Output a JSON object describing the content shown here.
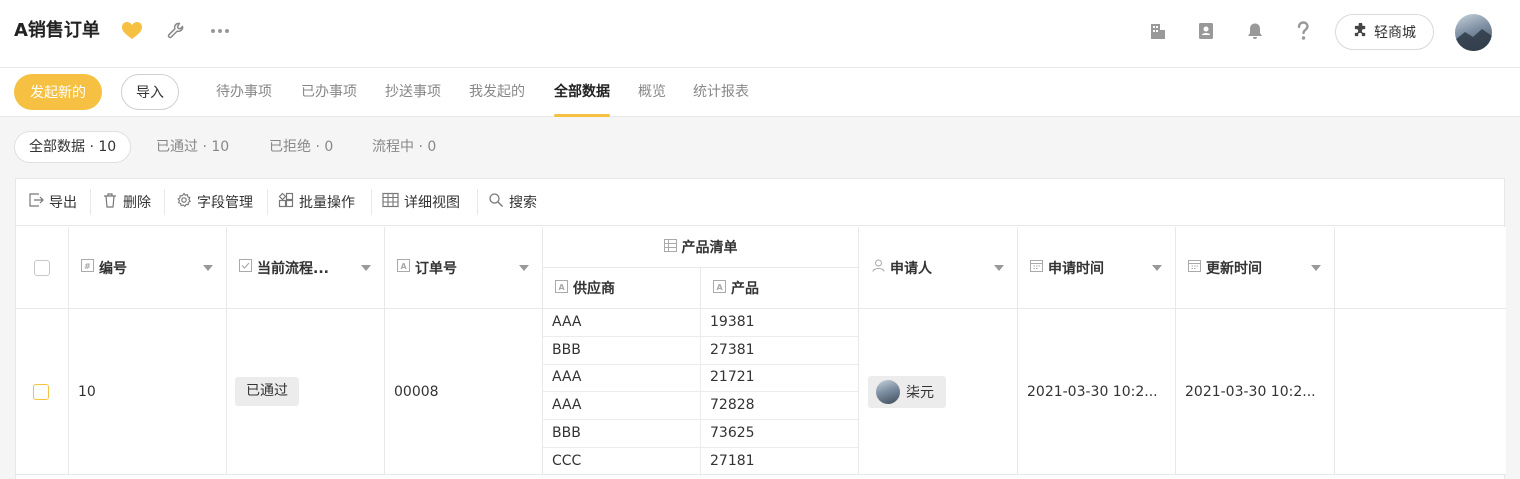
{
  "app": {
    "title": "A销售订单"
  },
  "header": {
    "mall_label": "轻商城"
  },
  "nav": {
    "start_label": "发起新的",
    "import_label": "导入",
    "tabs": [
      {
        "label": "待办事项"
      },
      {
        "label": "已办事项"
      },
      {
        "label": "抄送事项"
      },
      {
        "label": "我发起的"
      },
      {
        "label": "全部数据",
        "active": true
      },
      {
        "label": "概览"
      },
      {
        "label": "统计报表"
      }
    ]
  },
  "filters": [
    {
      "label": "全部数据 · 10",
      "active": true
    },
    {
      "label": "已通过 · 10"
    },
    {
      "label": "已拒绝 · 0"
    },
    {
      "label": "流程中 · 0"
    }
  ],
  "toolbar": {
    "export": "导出",
    "delete": "删除",
    "fields": "字段管理",
    "batch": "批量操作",
    "detail_view": "详细视图",
    "search": "搜索"
  },
  "table": {
    "columns": {
      "id": "编号",
      "status": "当前流程...",
      "order_no": "订单号",
      "product_list": "产品清单",
      "supplier": "供应商",
      "product": "产品",
      "applicant": "申请人",
      "apply_time": "申请时间",
      "update_time": "更新时间"
    },
    "rows": [
      {
        "id": "10",
        "status": "已通过",
        "order_no": "00008",
        "items": [
          {
            "supplier": "AAA",
            "product": "19381"
          },
          {
            "supplier": "BBB",
            "product": "27381"
          },
          {
            "supplier": "AAA",
            "product": "21721"
          },
          {
            "supplier": "AAA",
            "product": "72828"
          },
          {
            "supplier": "BBB",
            "product": "73625"
          },
          {
            "supplier": "CCC",
            "product": "27181"
          }
        ],
        "applicant": "柒元",
        "apply_time": "2021-03-30 10:2...",
        "update_time": "2021-03-30 10:2..."
      }
    ]
  },
  "colors": {
    "accent": "#f6c142",
    "heart": "#f6c142"
  }
}
